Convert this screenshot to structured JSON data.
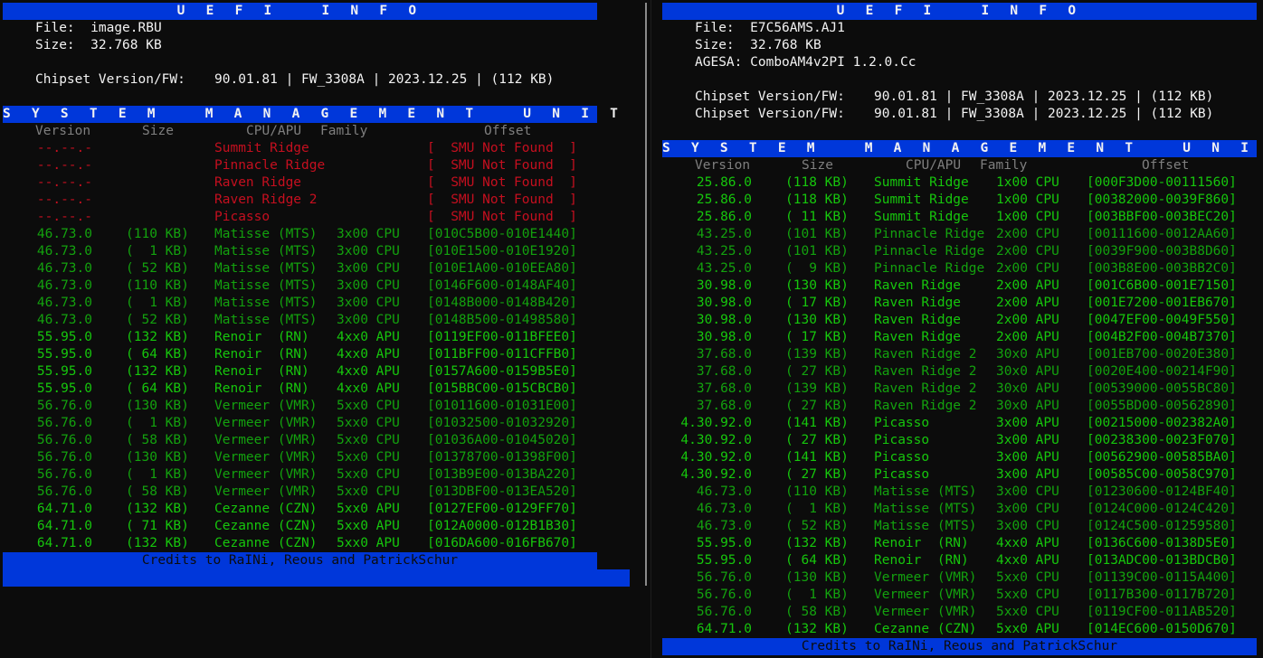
{
  "title": "U E F I   I N F O",
  "smu_title": "S Y S T E M   M A N A G E M E N T   U N I T   [ S M U ]",
  "credits": "Credits to RaINi, Reous and PatrickSchur",
  "headers": {
    "version": "Version",
    "size": "Size",
    "cpuapu": "CPU/APU",
    "family": "Family",
    "offset": "Offset"
  },
  "colors": {
    "banner_blue": "#0037da",
    "not_found_red": "#c50f1f",
    "green": "#13a10e",
    "bright_green": "#16c60c",
    "background": "#0c0c0c"
  },
  "left": {
    "file_label": "File:",
    "file_value": "image.RBU",
    "size_label": "Size:",
    "size_value": "32.768 KB",
    "chipset_label": "Chipset Version/FW:",
    "chipset_value": "90.01.81 | FW_3308A | 2023.12.25 | (112 KB)",
    "rows": [
      {
        "version": "--.--.-",
        "size": "",
        "name": "Summit Ridge",
        "family": "",
        "offset": "[  SMU Not Found  ]",
        "state": "missing"
      },
      {
        "version": "--.--.-",
        "size": "",
        "name": "Pinnacle Ridge",
        "family": "",
        "offset": "[  SMU Not Found  ]",
        "state": "missing"
      },
      {
        "version": "--.--.-",
        "size": "",
        "name": "Raven Ridge",
        "family": "",
        "offset": "[  SMU Not Found  ]",
        "state": "missing"
      },
      {
        "version": "--.--.-",
        "size": "",
        "name": "Raven Ridge 2",
        "family": "",
        "offset": "[  SMU Not Found  ]",
        "state": "missing"
      },
      {
        "version": "--.--.-",
        "size": "",
        "name": "Picasso",
        "family": "",
        "offset": "[  SMU Not Found  ]",
        "state": "missing"
      },
      {
        "version": "46.73.0",
        "size": "(110 KB)",
        "name": "Matisse (MTS)",
        "family": "3x00 CPU",
        "offset": "[010C5B00-010E1440]",
        "state": "dim"
      },
      {
        "version": "46.73.0",
        "size": "(  1 KB)",
        "name": "Matisse (MTS)",
        "family": "3x00 CPU",
        "offset": "[010E1500-010E1920]",
        "state": "dim"
      },
      {
        "version": "46.73.0",
        "size": "( 52 KB)",
        "name": "Matisse (MTS)",
        "family": "3x00 CPU",
        "offset": "[010E1A00-010EEA80]",
        "state": "dim"
      },
      {
        "version": "46.73.0",
        "size": "(110 KB)",
        "name": "Matisse (MTS)",
        "family": "3x00 CPU",
        "offset": "[0146F600-0148AF40]",
        "state": "dim"
      },
      {
        "version": "46.73.0",
        "size": "(  1 KB)",
        "name": "Matisse (MTS)",
        "family": "3x00 CPU",
        "offset": "[0148B000-0148B420]",
        "state": "dim"
      },
      {
        "version": "46.73.0",
        "size": "( 52 KB)",
        "name": "Matisse (MTS)",
        "family": "3x00 CPU",
        "offset": "[0148B500-01498580]",
        "state": "dim"
      },
      {
        "version": "55.95.0",
        "size": "(132 KB)",
        "name": "Renoir  (RN)",
        "family": "4xx0 APU",
        "offset": "[0119EF00-011BFEE0]",
        "state": "bright"
      },
      {
        "version": "55.95.0",
        "size": "( 64 KB)",
        "name": "Renoir  (RN)",
        "family": "4xx0 APU",
        "offset": "[011BFF00-011CFFB0]",
        "state": "bright"
      },
      {
        "version": "55.95.0",
        "size": "(132 KB)",
        "name": "Renoir  (RN)",
        "family": "4xx0 APU",
        "offset": "[0157A600-0159B5E0]",
        "state": "bright"
      },
      {
        "version": "55.95.0",
        "size": "( 64 KB)",
        "name": "Renoir  (RN)",
        "family": "4xx0 APU",
        "offset": "[015BBC00-015CBCB0]",
        "state": "bright"
      },
      {
        "version": "56.76.0",
        "size": "(130 KB)",
        "name": "Vermeer (VMR)",
        "family": "5xx0 CPU",
        "offset": "[01011600-01031E00]",
        "state": "dim"
      },
      {
        "version": "56.76.0",
        "size": "(  1 KB)",
        "name": "Vermeer (VMR)",
        "family": "5xx0 CPU",
        "offset": "[01032500-01032920]",
        "state": "dim"
      },
      {
        "version": "56.76.0",
        "size": "( 58 KB)",
        "name": "Vermeer (VMR)",
        "family": "5xx0 CPU",
        "offset": "[01036A00-01045020]",
        "state": "dim"
      },
      {
        "version": "56.76.0",
        "size": "(130 KB)",
        "name": "Vermeer (VMR)",
        "family": "5xx0 CPU",
        "offset": "[01378700-01398F00]",
        "state": "dim"
      },
      {
        "version": "56.76.0",
        "size": "(  1 KB)",
        "name": "Vermeer (VMR)",
        "family": "5xx0 CPU",
        "offset": "[013B9E00-013BA220]",
        "state": "dim"
      },
      {
        "version": "56.76.0",
        "size": "( 58 KB)",
        "name": "Vermeer (VMR)",
        "family": "5xx0 CPU",
        "offset": "[013DBF00-013EA520]",
        "state": "dim"
      },
      {
        "version": "64.71.0",
        "size": "(132 KB)",
        "name": "Cezanne (CZN)",
        "family": "5xx0 APU",
        "offset": "[0127EF00-0129FF70]",
        "state": "bright"
      },
      {
        "version": "64.71.0",
        "size": "( 71 KB)",
        "name": "Cezanne (CZN)",
        "family": "5xx0 APU",
        "offset": "[012A0000-012B1B30]",
        "state": "bright"
      },
      {
        "version": "64.71.0",
        "size": "(132 KB)",
        "name": "Cezanne (CZN)",
        "family": "5xx0 APU",
        "offset": "[016DA600-016FB670]",
        "state": "bright"
      }
    ]
  },
  "right": {
    "file_label": "File:",
    "file_value": "E7C56AMS.AJ1",
    "size_label": "Size:",
    "size_value": "32.768 KB",
    "agesa_label": "AGESA:",
    "agesa_value": "ComboAM4v2PI 1.2.0.Cc",
    "chipset_label": "Chipset Version/FW:",
    "chipset_value": "90.01.81 | FW_3308A | 2023.12.25 | (112 KB)",
    "chipset_label_2": "Chipset Version/FW:",
    "chipset_value_2": "90.01.81 | FW_3308A | 2023.12.25 | (112 KB)",
    "rows": [
      {
        "version": "25.86.0",
        "size": "(118 KB)",
        "name": "Summit Ridge",
        "family": "1x00 CPU",
        "offset": "[000F3D00-00111560]",
        "state": "bright"
      },
      {
        "version": "25.86.0",
        "size": "(118 KB)",
        "name": "Summit Ridge",
        "family": "1x00 CPU",
        "offset": "[00382000-0039F860]",
        "state": "bright"
      },
      {
        "version": "25.86.0",
        "size": "( 11 KB)",
        "name": "Summit Ridge",
        "family": "1x00 CPU",
        "offset": "[003BBF00-003BEC20]",
        "state": "bright"
      },
      {
        "version": "43.25.0",
        "size": "(101 KB)",
        "name": "Pinnacle Ridge",
        "family": "2x00 CPU",
        "offset": "[00111600-0012AA60]",
        "state": "dim"
      },
      {
        "version": "43.25.0",
        "size": "(101 KB)",
        "name": "Pinnacle Ridge",
        "family": "2x00 CPU",
        "offset": "[0039F900-003B8D60]",
        "state": "dim"
      },
      {
        "version": "43.25.0",
        "size": "(  9 KB)",
        "name": "Pinnacle Ridge",
        "family": "2x00 CPU",
        "offset": "[003B8E00-003BB2C0]",
        "state": "dim"
      },
      {
        "version": "30.98.0",
        "size": "(130 KB)",
        "name": "Raven Ridge",
        "family": "2x00 APU",
        "offset": "[001C6B00-001E7150]",
        "state": "bright"
      },
      {
        "version": "30.98.0",
        "size": "( 17 KB)",
        "name": "Raven Ridge",
        "family": "2x00 APU",
        "offset": "[001E7200-001EB670]",
        "state": "bright"
      },
      {
        "version": "30.98.0",
        "size": "(130 KB)",
        "name": "Raven Ridge",
        "family": "2x00 APU",
        "offset": "[0047EF00-0049F550]",
        "state": "bright"
      },
      {
        "version": "30.98.0",
        "size": "( 17 KB)",
        "name": "Raven Ridge",
        "family": "2x00 APU",
        "offset": "[004B2F00-004B7370]",
        "state": "bright"
      },
      {
        "version": "37.68.0",
        "size": "(139 KB)",
        "name": "Raven Ridge 2",
        "family": "30x0 APU",
        "offset": "[001EB700-0020E380]",
        "state": "dim"
      },
      {
        "version": "37.68.0",
        "size": "( 27 KB)",
        "name": "Raven Ridge 2",
        "family": "30x0 APU",
        "offset": "[0020E400-00214F90]",
        "state": "dim"
      },
      {
        "version": "37.68.0",
        "size": "(139 KB)",
        "name": "Raven Ridge 2",
        "family": "30x0 APU",
        "offset": "[00539000-0055BC80]",
        "state": "dim"
      },
      {
        "version": "37.68.0",
        "size": "( 27 KB)",
        "name": "Raven Ridge 2",
        "family": "30x0 APU",
        "offset": "[0055BD00-00562890]",
        "state": "dim"
      },
      {
        "version": "4.30.92.0",
        "size": "(141 KB)",
        "name": "Picasso",
        "family": "3x00 APU",
        "offset": "[00215000-002382A0]",
        "state": "bright"
      },
      {
        "version": "4.30.92.0",
        "size": "( 27 KB)",
        "name": "Picasso",
        "family": "3x00 APU",
        "offset": "[00238300-0023F070]",
        "state": "bright"
      },
      {
        "version": "4.30.92.0",
        "size": "(141 KB)",
        "name": "Picasso",
        "family": "3x00 APU",
        "offset": "[00562900-00585BA0]",
        "state": "bright"
      },
      {
        "version": "4.30.92.0",
        "size": "( 27 KB)",
        "name": "Picasso",
        "family": "3x00 APU",
        "offset": "[00585C00-0058C970]",
        "state": "bright"
      },
      {
        "version": "46.73.0",
        "size": "(110 KB)",
        "name": "Matisse (MTS)",
        "family": "3x00 CPU",
        "offset": "[01230600-0124BF40]",
        "state": "dim"
      },
      {
        "version": "46.73.0",
        "size": "(  1 KB)",
        "name": "Matisse (MTS)",
        "family": "3x00 CPU",
        "offset": "[0124C000-0124C420]",
        "state": "dim"
      },
      {
        "version": "46.73.0",
        "size": "( 52 KB)",
        "name": "Matisse (MTS)",
        "family": "3x00 CPU",
        "offset": "[0124C500-01259580]",
        "state": "dim"
      },
      {
        "version": "55.95.0",
        "size": "(132 KB)",
        "name": "Renoir  (RN)",
        "family": "4xx0 APU",
        "offset": "[0136C600-0138D5E0]",
        "state": "bright"
      },
      {
        "version": "55.95.0",
        "size": "( 64 KB)",
        "name": "Renoir  (RN)",
        "family": "4xx0 APU",
        "offset": "[013ADC00-013BDCB0]",
        "state": "bright"
      },
      {
        "version": "56.76.0",
        "size": "(130 KB)",
        "name": "Vermeer (VMR)",
        "family": "5xx0 CPU",
        "offset": "[01139C00-0115A400]",
        "state": "dim"
      },
      {
        "version": "56.76.0",
        "size": "(  1 KB)",
        "name": "Vermeer (VMR)",
        "family": "5xx0 CPU",
        "offset": "[0117B300-0117B720]",
        "state": "dim"
      },
      {
        "version": "56.76.0",
        "size": "( 58 KB)",
        "name": "Vermeer (VMR)",
        "family": "5xx0 CPU",
        "offset": "[0119CF00-011AB520]",
        "state": "dim"
      },
      {
        "version": "64.71.0",
        "size": "(132 KB)",
        "name": "Cezanne (CZN)",
        "family": "5xx0 APU",
        "offset": "[014EC600-0150D670]",
        "state": "bright"
      }
    ]
  }
}
